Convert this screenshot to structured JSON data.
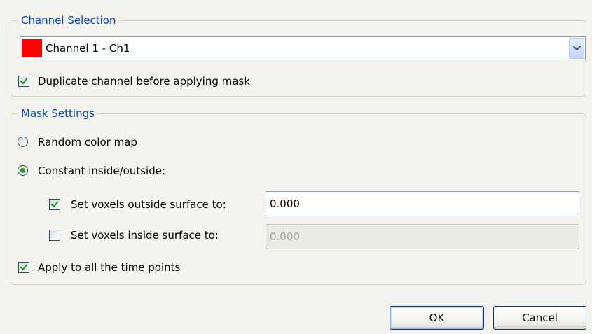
{
  "channel_selection": {
    "legend": "Channel Selection",
    "channel_combo": {
      "selected": "Channel 1 - Ch1",
      "swatch_color": "#ff0000"
    },
    "duplicate_checkbox": {
      "label": "Duplicate channel before applying mask",
      "checked": true
    }
  },
  "mask_settings": {
    "legend": "Mask Settings",
    "random_color_map": {
      "label": "Random color map",
      "selected": false
    },
    "constant_inside_outside": {
      "label": "Constant inside/outside:",
      "selected": true
    },
    "outside": {
      "label": "Set voxels outside surface to:",
      "checked": true,
      "value": "0.000"
    },
    "inside": {
      "label": "Set voxels inside surface to:",
      "checked": false,
      "value": "0.000"
    },
    "apply_all_time_points": {
      "label": "Apply to all the time points",
      "checked": true
    }
  },
  "buttons": {
    "ok": "OK",
    "cancel": "Cancel"
  },
  "colors": {
    "accent_legend": "#0046d5",
    "check_green": "#21a121",
    "background": "#f4f3ee"
  }
}
